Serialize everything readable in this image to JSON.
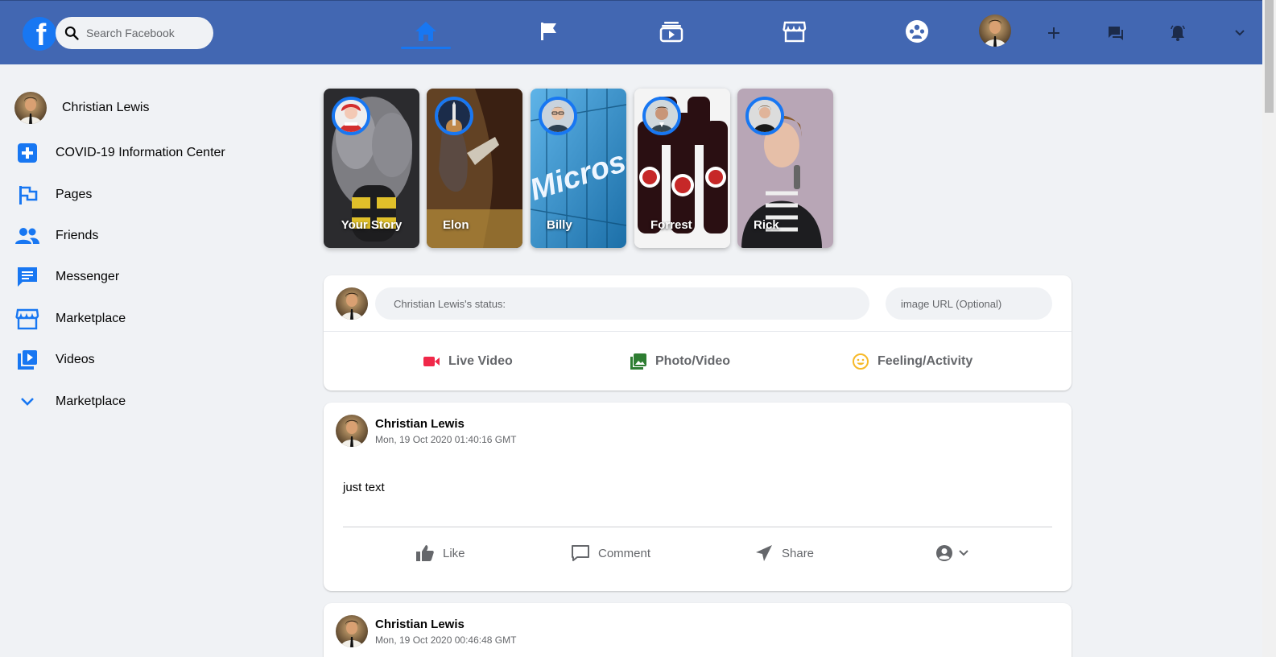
{
  "header": {
    "logo_letter": "f",
    "search_placeholder": "Search Facebook",
    "nav_icons": [
      "home-icon",
      "flag-icon",
      "watch-icon",
      "marketplace-icon",
      "groups-icon"
    ],
    "right_icons": [
      "plus-icon",
      "messenger-icon",
      "bell-icon",
      "chevron-down-icon"
    ],
    "accent_color": "#1877f2",
    "bar_color": "#4267b2"
  },
  "sidebar": {
    "user_name": "Christian Lewis",
    "items": [
      {
        "label": "COVID-19 Information Center",
        "icon": "covid-plus-icon"
      },
      {
        "label": "Pages",
        "icon": "pages-flag-icon"
      },
      {
        "label": "Friends",
        "icon": "friends-icon"
      },
      {
        "label": "Messenger",
        "icon": "messenger-icon"
      },
      {
        "label": "Marketplace",
        "icon": "marketplace-icon"
      },
      {
        "label": "Videos",
        "icon": "videos-icon"
      },
      {
        "label": "Marketplace",
        "icon": "chevron-down-icon"
      }
    ]
  },
  "stories": [
    {
      "name": "Your Story"
    },
    {
      "name": "Elon"
    },
    {
      "name": "Billy"
    },
    {
      "name": "Forrest"
    },
    {
      "name": "Rick"
    }
  ],
  "composer": {
    "status_placeholder": "Christian Lewis's status:",
    "url_placeholder": "image URL (Optional)",
    "options": [
      {
        "label": "Live Video",
        "icon": "live-video-icon",
        "color": "#f02849"
      },
      {
        "label": "Photo/Video",
        "icon": "photo-icon",
        "color": "#2e7d32"
      },
      {
        "label": "Feeling/Activity",
        "icon": "smiley-icon",
        "color": "#f7b928"
      }
    ]
  },
  "posts": [
    {
      "author": "Christian Lewis",
      "time": "Mon, 19 Oct 2020 01:40:16 GMT",
      "text": "just text",
      "actions": {
        "like": "Like",
        "comment": "Comment",
        "share": "Share"
      }
    },
    {
      "author": "Christian Lewis",
      "time": "Mon, 19 Oct 2020 00:46:48 GMT"
    }
  ]
}
